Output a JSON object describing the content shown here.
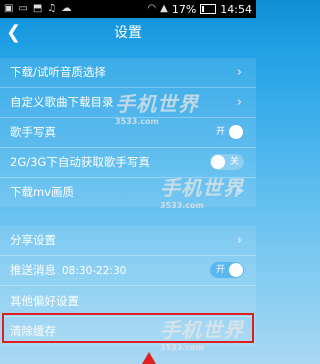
{
  "status_bar": {
    "left_icons": [
      "image-icon",
      "screen-icon",
      "shirt-icon",
      "headphones-icon",
      "cloud-icon"
    ],
    "battery": "17%",
    "time": "14:54"
  },
  "header": {
    "title": "设置",
    "back_icon": "chevron-left-icon"
  },
  "groups": [
    {
      "rows": [
        {
          "label": "下载/试听音质选择",
          "control": "chevron"
        },
        {
          "label": "自定义歌曲下载目录",
          "control": "chevron"
        },
        {
          "label": "歌手写真",
          "control": "toggle",
          "toggle_text": "开",
          "on": true
        },
        {
          "label": "2G/3G下自动获取歌手写真",
          "control": "toggle",
          "toggle_text": "关",
          "on": false
        },
        {
          "label": "下载mv画质",
          "control": "chevron"
        }
      ]
    },
    {
      "rows": [
        {
          "label": "分享设置",
          "control": "chevron"
        },
        {
          "label": "推送消息",
          "time": "08:30-22:30",
          "control": "toggle",
          "toggle_text": "开",
          "on": true
        },
        {
          "label": "其他偏好设置",
          "control": "chevron"
        },
        {
          "label": "清除缓存",
          "control": "chevron"
        }
      ]
    }
  ],
  "watermarks": [
    {
      "main": "手机世界",
      "sub": "3533.com"
    }
  ],
  "colors": {
    "highlight": "#e02020",
    "toggle_on": "#5bb8ef"
  }
}
